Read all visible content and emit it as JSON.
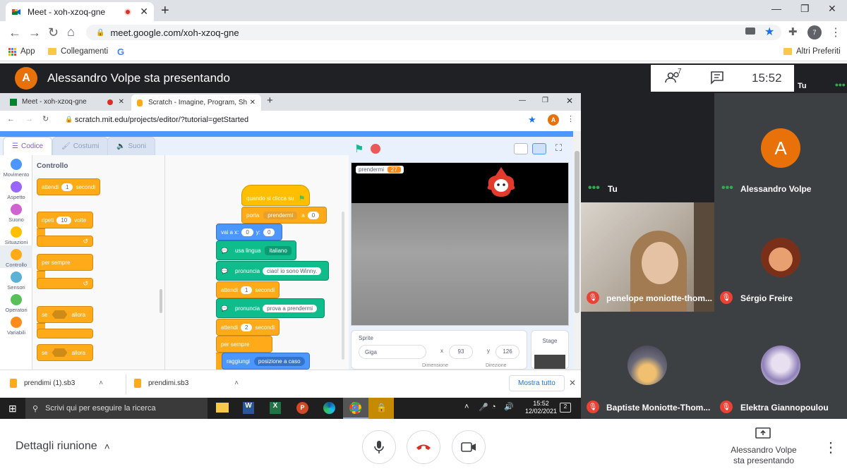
{
  "browser": {
    "tab_title": "Meet - xoh-xzoq-gne",
    "url": "meet.google.com/xoh-xzoq-gne",
    "bookmarks": {
      "apps": "App",
      "links": "Collegamenti",
      "other": "Altri Preferiti"
    },
    "extension_badge": "7"
  },
  "meet": {
    "presenter_initial": "A",
    "presenting_title": "Alessandro Volpe sta presentando",
    "participant_count": "7",
    "clock": "15:52",
    "self_label": "Tu",
    "details_label": "Dettagli riunione",
    "presenting_footer": "Alessandro Volpe\nsta presentando",
    "participants": [
      {
        "name": "Tu",
        "muted": false
      },
      {
        "name": "Alessandro Volpe",
        "initial": "A",
        "muted": false
      },
      {
        "name": "penelope moniotte-thom...",
        "muted": true
      },
      {
        "name": "Sérgio Freire",
        "muted": true
      },
      {
        "name": "Baptiste Moniotte-Thom...",
        "muted": true
      },
      {
        "name": "Elektra Giannopoulou",
        "muted": true
      }
    ]
  },
  "shared": {
    "tabs": [
      {
        "title": "Meet - xoh-xzoq-gne"
      },
      {
        "title": "Scratch - Imagine, Program, Shar"
      }
    ],
    "url": "scratch.mit.edu/projects/editor/?tutorial=getStarted",
    "avatar_initial": "A",
    "scratch": {
      "tabs": [
        "Codice",
        "Costumi",
        "Suoni"
      ],
      "categories": [
        {
          "label": "Movimento",
          "color": "#4c97ff"
        },
        {
          "label": "Aspetto",
          "color": "#9966ff"
        },
        {
          "label": "Suono",
          "color": "#cf63cf"
        },
        {
          "label": "Situazioni",
          "color": "#ffbf00"
        },
        {
          "label": "Controllo",
          "color": "#ffab19"
        },
        {
          "label": "Sensori",
          "color": "#5cb1d6"
        },
        {
          "label": "Operatori",
          "color": "#59c059"
        },
        {
          "label": "Variabili",
          "color": "#ff8c1a"
        }
      ],
      "palette_title": "Controllo",
      "palette": {
        "wait": "attendi",
        "wait_val": "1",
        "wait_unit": "secondi",
        "repeat": "ripeti",
        "repeat_val": "10",
        "repeat_unit": "volte",
        "forever": "per sempre",
        "if1": "se",
        "if1_then": "allora",
        "if2": "se",
        "if2_then": "allora"
      },
      "script": {
        "hat": "quando si clicca su",
        "goto_layer": "porta",
        "goto_layer_dd": "prendermi",
        "goto_layer_to": "a",
        "goto_layer_val": "0",
        "goto": "vai a x:",
        "goto_x": "0",
        "goto_y_label": "y:",
        "goto_y": "0",
        "lang": "usa lingua",
        "lang_dd": "italiano",
        "speak1": "pronuncia",
        "speak1_val": "ciao! io sono Winny.",
        "wait1": "attendi",
        "wait1_val": "1",
        "wait1_unit": "secondi",
        "speak2": "pronuncia",
        "speak2_val": "prova a prendermi",
        "wait2": "attendi",
        "wait2_val": "2",
        "wait2_unit": "secondi",
        "forever": "per sempre",
        "glide": "raggiungi",
        "glide_dd": "posizione a caso"
      },
      "stage_monitor": {
        "label": "prendermi",
        "value": "27"
      },
      "sprite": {
        "title": "Sprite",
        "name": "Giga",
        "x_label": "x",
        "x": "93",
        "y_label": "y",
        "y": "126",
        "size_label": "Dimensione",
        "dir_label": "Direzione"
      },
      "stage_label": "Stage"
    },
    "downloads": {
      "items": [
        "prendimi (1).sb3",
        "prendimi.sb3"
      ],
      "show_all": "Mostra tutto"
    },
    "taskbar": {
      "search": "Scrivi qui per eseguire la ricerca",
      "time": "15:52",
      "date": "12/02/2021",
      "notif_count": "2"
    }
  }
}
